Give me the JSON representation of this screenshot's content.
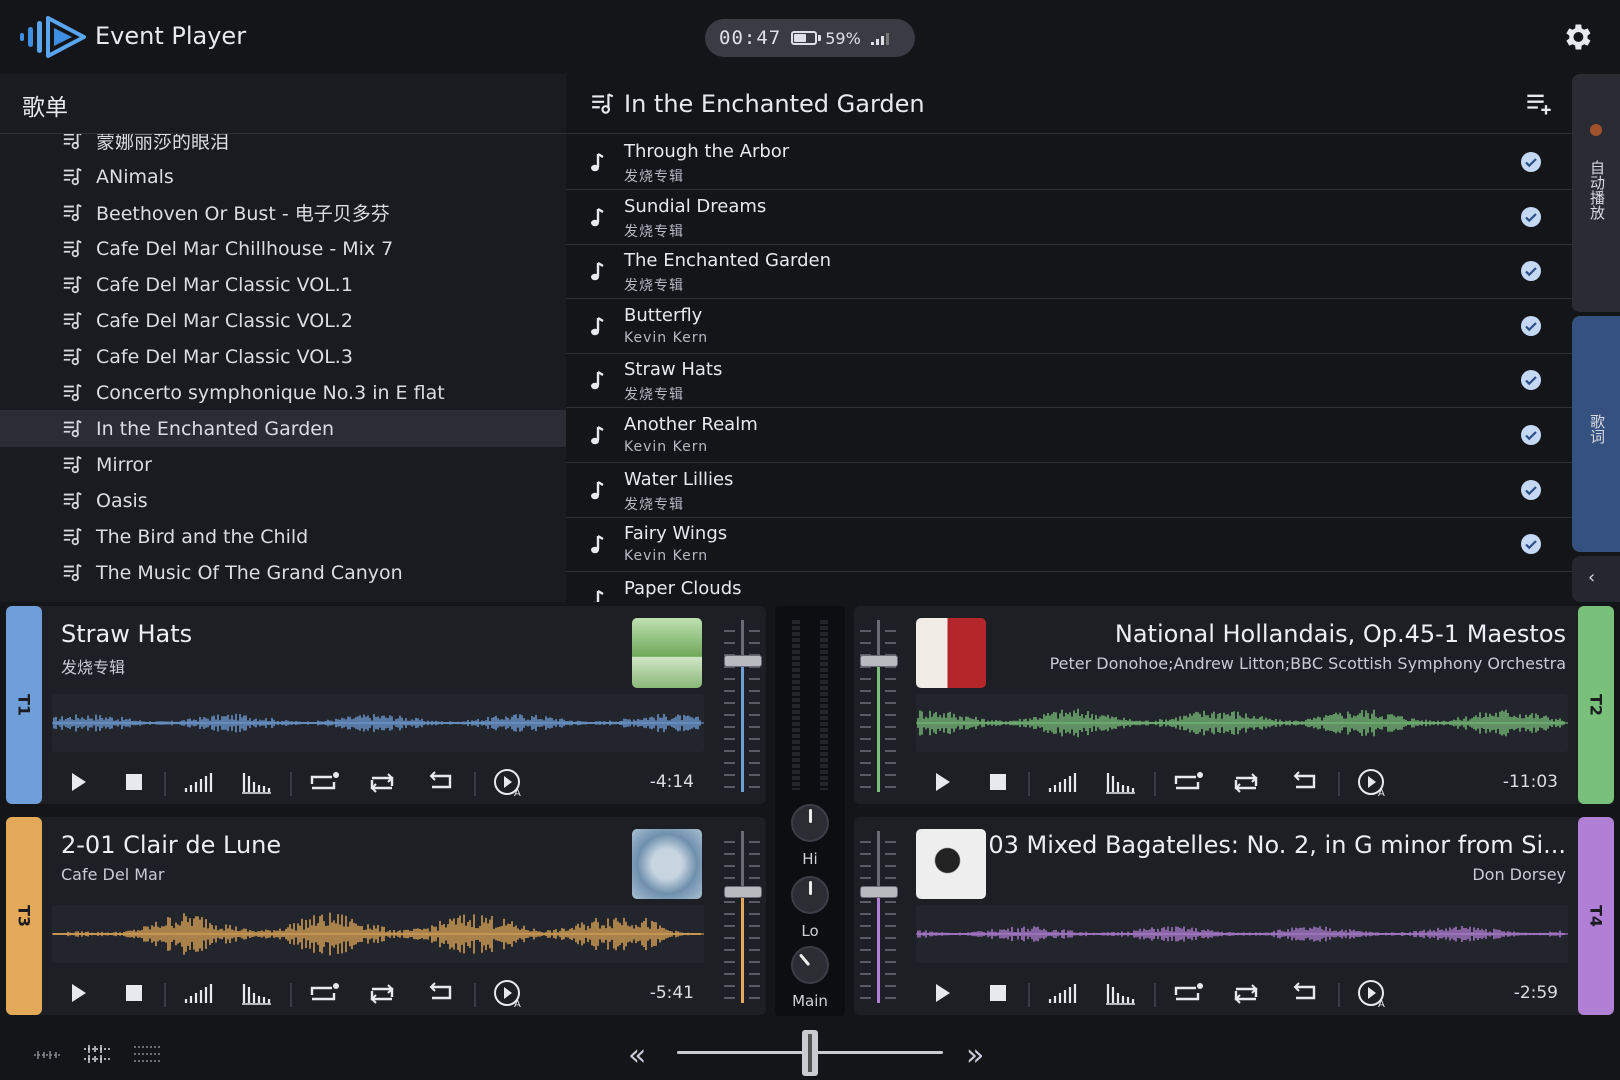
{
  "app": {
    "title": "Event Player"
  },
  "status": {
    "time": "00:47",
    "battery": "59%",
    "battery_level": 0.59
  },
  "playlists": {
    "header": "歌单",
    "items": [
      {
        "label": "蒙娜丽莎的眼泪"
      },
      {
        "label": "ANimals"
      },
      {
        "label": "Beethoven Or Bust - 电子贝多芬"
      },
      {
        "label": "Cafe Del Mar Chillhouse - Mix 7"
      },
      {
        "label": "Cafe Del Mar Classic VOL.1"
      },
      {
        "label": "Cafe Del Mar Classic VOL.2"
      },
      {
        "label": "Cafe Del Mar Classic VOL.3"
      },
      {
        "label": "Concerto symphonique No.3 in E flat"
      },
      {
        "label": "In the Enchanted Garden",
        "active": true
      },
      {
        "label": "Mirror"
      },
      {
        "label": "Oasis"
      },
      {
        "label": "The Bird and the Child"
      },
      {
        "label": "The Music Of The Grand Canyon"
      }
    ]
  },
  "playlist_view": {
    "title": "In the Enchanted Garden",
    "tracks": [
      {
        "title": "Through the Arbor",
        "artist": "发烧专辑"
      },
      {
        "title": "Sundial Dreams",
        "artist": "发烧专辑"
      },
      {
        "title": "The Enchanted Garden",
        "artist": "发烧专辑"
      },
      {
        "title": "Butterfly",
        "artist": "Kevin Kern"
      },
      {
        "title": "Straw Hats",
        "artist": "发烧专辑"
      },
      {
        "title": "Another Realm",
        "artist": "Kevin Kern"
      },
      {
        "title": "Water Lillies",
        "artist": "发烧专辑"
      },
      {
        "title": "Fairy Wings",
        "artist": "Kevin Kern"
      },
      {
        "title": "Paper Clouds",
        "artist": ""
      }
    ]
  },
  "side_tabs": {
    "autoplay": "自动播放",
    "lyrics": "歌词"
  },
  "decks": [
    {
      "tab": "T1",
      "title": "Straw Hats",
      "subtitle": "发烧专辑",
      "time": "-4:14",
      "color": "#6f9fd8",
      "fader_level": 0.88
    },
    {
      "tab": "T2",
      "title": "National Hollandais, Op.45-1 Maestos",
      "subtitle": "Peter Donohoe;Andrew Litton;BBC Scottish Symphony Orchestra",
      "time": "-11:03",
      "color": "#79c07a",
      "fader_level": 0.88
    },
    {
      "tab": "T3",
      "title": "2-01 Clair de Lune",
      "subtitle": "Cafe Del Mar",
      "time": "-5:41",
      "color": "#e3a959",
      "fader_level": 0.76
    },
    {
      "tab": "T4",
      "title": "03 Mixed Bagatelles: No. 2, in G minor from Si...",
      "subtitle": "Don Dorsey",
      "time": "-2:59",
      "color": "#b17fd6",
      "fader_level": 0.76
    }
  ],
  "mixer": {
    "hi_label": "Hi",
    "lo_label": "Lo",
    "main_label": "Main"
  },
  "crossfader": {
    "position": 0.5,
    "left_arrow": "«",
    "right_arrow": "»"
  }
}
